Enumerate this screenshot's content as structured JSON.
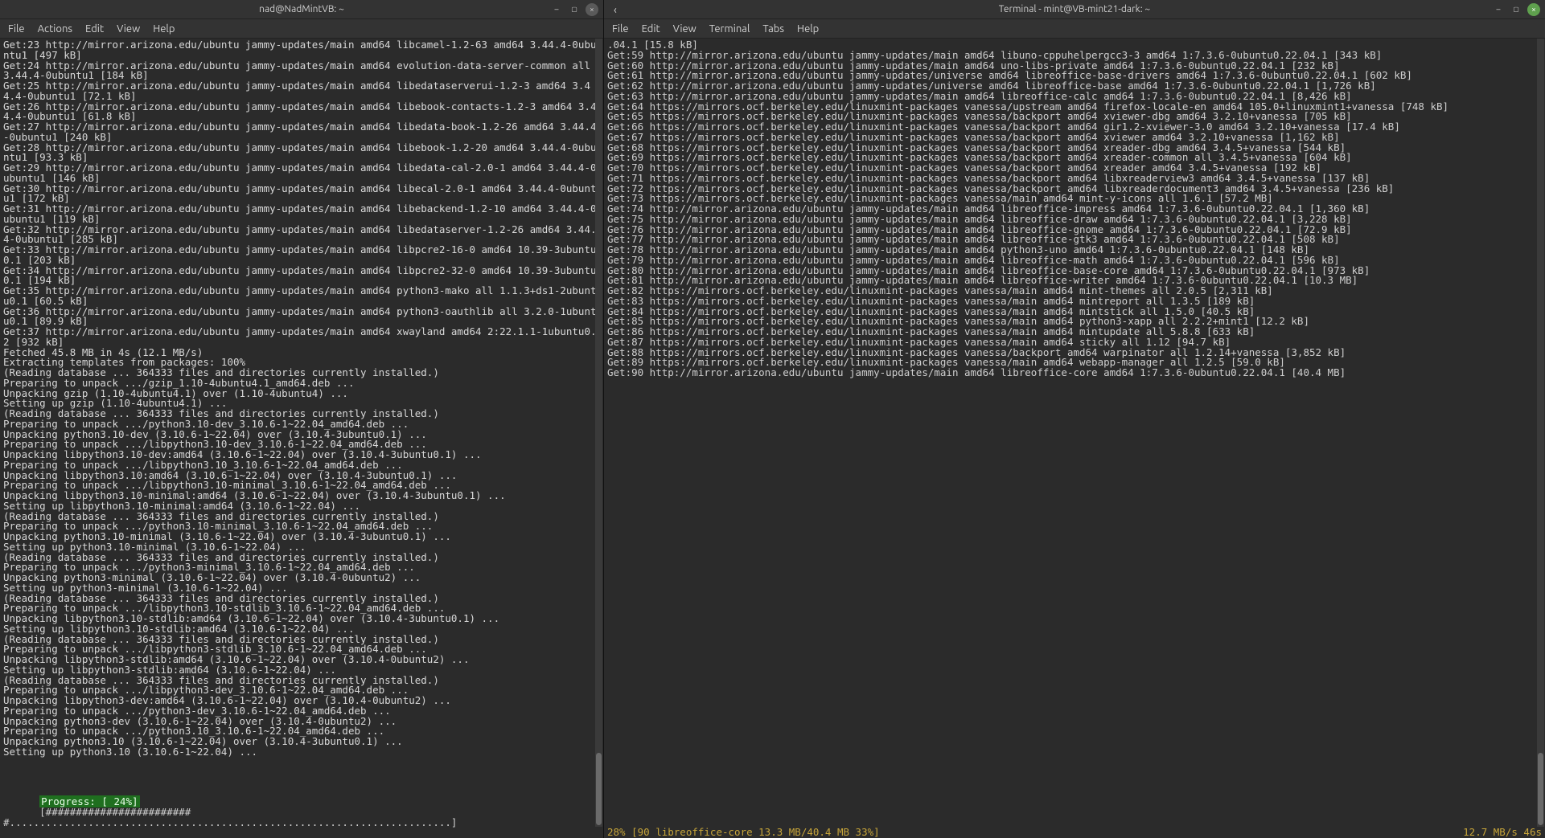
{
  "left": {
    "title": "nad@NadMintVB: ~",
    "menus": [
      "File",
      "Actions",
      "Edit",
      "View",
      "Help"
    ],
    "lines": [
      "Get:23 http://mirror.arizona.edu/ubuntu jammy-updates/main amd64 libcamel-1.2-63 amd64 3.44.4-0ubuntu1 [497 kB]",
      "Get:24 http://mirror.arizona.edu/ubuntu jammy-updates/main amd64 evolution-data-server-common all 3.44.4-0ubuntu1 [184 kB]",
      "Get:25 http://mirror.arizona.edu/ubuntu jammy-updates/main amd64 libedataserverui-1.2-3 amd64 3.44.4-0ubuntu1 [72.1 kB]",
      "Get:26 http://mirror.arizona.edu/ubuntu jammy-updates/main amd64 libebook-contacts-1.2-3 amd64 3.44.4-0ubuntu1 [61.8 kB]",
      "Get:27 http://mirror.arizona.edu/ubuntu jammy-updates/main amd64 libedata-book-1.2-26 amd64 3.44.4-0ubuntu1 [240 kB]",
      "Get:28 http://mirror.arizona.edu/ubuntu jammy-updates/main amd64 libebook-1.2-20 amd64 3.44.4-0ubuntu1 [93.3 kB]",
      "Get:29 http://mirror.arizona.edu/ubuntu jammy-updates/main amd64 libedata-cal-2.0-1 amd64 3.44.4-0ubuntu1 [146 kB]",
      "Get:30 http://mirror.arizona.edu/ubuntu jammy-updates/main amd64 libecal-2.0-1 amd64 3.44.4-0ubuntu1 [172 kB]",
      "Get:31 http://mirror.arizona.edu/ubuntu jammy-updates/main amd64 libebackend-1.2-10 amd64 3.44.4-0ubuntu1 [119 kB]",
      "Get:32 http://mirror.arizona.edu/ubuntu jammy-updates/main amd64 libedataserver-1.2-26 amd64 3.44.4-0ubuntu1 [285 kB]",
      "Get:33 http://mirror.arizona.edu/ubuntu jammy-updates/main amd64 libpcre2-16-0 amd64 10.39-3ubuntu0.1 [203 kB]",
      "Get:34 http://mirror.arizona.edu/ubuntu jammy-updates/main amd64 libpcre2-32-0 amd64 10.39-3ubuntu0.1 [194 kB]",
      "Get:35 http://mirror.arizona.edu/ubuntu jammy-updates/main amd64 python3-mako all 1.1.3+ds1-2ubuntu0.1 [60.5 kB]",
      "Get:36 http://mirror.arizona.edu/ubuntu jammy-updates/main amd64 python3-oauthlib all 3.2.0-1ubuntu0.1 [89.9 kB]",
      "Get:37 http://mirror.arizona.edu/ubuntu jammy-updates/main amd64 xwayland amd64 2:22.1.1-1ubuntu0.2 [932 kB]",
      "Fetched 45.8 MB in 4s (12.1 MB/s)",
      "Extracting templates from packages: 100%",
      "(Reading database ... 364333 files and directories currently installed.)",
      "Preparing to unpack .../gzip_1.10-4ubuntu4.1_amd64.deb ...",
      "Unpacking gzip (1.10-4ubuntu4.1) over (1.10-4ubuntu4) ...",
      "Setting up gzip (1.10-4ubuntu4.1) ...",
      "(Reading database ... 364333 files and directories currently installed.)",
      "Preparing to unpack .../python3.10-dev_3.10.6-1~22.04_amd64.deb ...",
      "Unpacking python3.10-dev (3.10.6-1~22.04) over (3.10.4-3ubuntu0.1) ...",
      "Preparing to unpack .../libpython3.10-dev_3.10.6-1~22.04_amd64.deb ...",
      "Unpacking libpython3.10-dev:amd64 (3.10.6-1~22.04) over (3.10.4-3ubuntu0.1) ...",
      "Preparing to unpack .../libpython3.10_3.10.6-1~22.04_amd64.deb ...",
      "Unpacking libpython3.10:amd64 (3.10.6-1~22.04) over (3.10.4-3ubuntu0.1) ...",
      "Preparing to unpack .../libpython3.10-minimal_3.10.6-1~22.04_amd64.deb ...",
      "Unpacking libpython3.10-minimal:amd64 (3.10.6-1~22.04) over (3.10.4-3ubuntu0.1) ...",
      "Setting up libpython3.10-minimal:amd64 (3.10.6-1~22.04) ...",
      "(Reading database ... 364333 files and directories currently installed.)",
      "Preparing to unpack .../python3.10-minimal_3.10.6-1~22.04_amd64.deb ...",
      "Unpacking python3.10-minimal (3.10.6-1~22.04) over (3.10.4-3ubuntu0.1) ...",
      "Setting up python3.10-minimal (3.10.6-1~22.04) ...",
      "(Reading database ... 364333 files and directories currently installed.)",
      "Preparing to unpack .../python3-minimal_3.10.6-1~22.04_amd64.deb ...",
      "Unpacking python3-minimal (3.10.6-1~22.04) over (3.10.4-0ubuntu2) ...",
      "Setting up python3-minimal (3.10.6-1~22.04) ...",
      "(Reading database ... 364333 files and directories currently installed.)",
      "Preparing to unpack .../libpython3.10-stdlib_3.10.6-1~22.04_amd64.deb ...",
      "Unpacking libpython3.10-stdlib:amd64 (3.10.6-1~22.04) over (3.10.4-3ubuntu0.1) ...",
      "Setting up libpython3.10-stdlib:amd64 (3.10.6-1~22.04) ...",
      "(Reading database ... 364333 files and directories currently installed.)",
      "Preparing to unpack .../libpython3-stdlib_3.10.6-1~22.04_amd64.deb ...",
      "Unpacking libpython3-stdlib:amd64 (3.10.6-1~22.04) over (3.10.4-0ubuntu2) ...",
      "Setting up libpython3-stdlib:amd64 (3.10.6-1~22.04) ...",
      "(Reading database ... 364333 files and directories currently installed.)",
      "Preparing to unpack .../libpython3-dev_3.10.6-1~22.04_amd64.deb ...",
      "Unpacking libpython3-dev:amd64 (3.10.6-1~22.04) over (3.10.4-0ubuntu2) ...",
      "Preparing to unpack .../python3-dev_3.10.6-1~22.04_amd64.deb ...",
      "Unpacking python3-dev (3.10.6-1~22.04) over (3.10.4-0ubuntu2) ...",
      "Preparing to unpack .../python3.10_3.10.6-1~22.04_amd64.deb ...",
      "Unpacking python3.10 (3.10.6-1~22.04) over (3.10.4-3ubuntu0.1) ...",
      "Setting up python3.10 (3.10.6-1~22.04) ..."
    ],
    "progress": {
      "label": "Progress: [ 24%]",
      "bar": "[#########################.........................................................................]"
    }
  },
  "right": {
    "title": "Terminal - mint@VB-mint21-dark: ~",
    "menus": [
      "File",
      "Edit",
      "View",
      "Terminal",
      "Tabs",
      "Help"
    ],
    "lines": [
      ".04.1 [15.8 kB]",
      "Get:59 http://mirror.arizona.edu/ubuntu jammy-updates/main amd64 libuno-cppuhelpergcc3-3 amd64 1:7.3.6-0ubuntu0.22.04.1 [343 kB]",
      "Get:60 http://mirror.arizona.edu/ubuntu jammy-updates/main amd64 uno-libs-private amd64 1:7.3.6-0ubuntu0.22.04.1 [232 kB]",
      "Get:61 http://mirror.arizona.edu/ubuntu jammy-updates/universe amd64 libreoffice-base-drivers amd64 1:7.3.6-0ubuntu0.22.04.1 [602 kB]",
      "Get:62 http://mirror.arizona.edu/ubuntu jammy-updates/universe amd64 libreoffice-base amd64 1:7.3.6-0ubuntu0.22.04.1 [1,726 kB]",
      "Get:63 http://mirror.arizona.edu/ubuntu jammy-updates/main amd64 libreoffice-calc amd64 1:7.3.6-0ubuntu0.22.04.1 [8,426 kB]",
      "Get:64 https://mirrors.ocf.berkeley.edu/linuxmint-packages vanessa/upstream amd64 firefox-locale-en amd64 105.0+linuxmint1+vanessa [748 kB]",
      "Get:65 https://mirrors.ocf.berkeley.edu/linuxmint-packages vanessa/backport amd64 xviewer-dbg amd64 3.2.10+vanessa [705 kB]",
      "Get:66 https://mirrors.ocf.berkeley.edu/linuxmint-packages vanessa/backport amd64 gir1.2-xviewer-3.0 amd64 3.2.10+vanessa [17.4 kB]",
      "Get:67 https://mirrors.ocf.berkeley.edu/linuxmint-packages vanessa/backport amd64 xviewer amd64 3.2.10+vanessa [1,162 kB]",
      "Get:68 https://mirrors.ocf.berkeley.edu/linuxmint-packages vanessa/backport amd64 xreader-dbg amd64 3.4.5+vanessa [544 kB]",
      "Get:69 https://mirrors.ocf.berkeley.edu/linuxmint-packages vanessa/backport amd64 xreader-common all 3.4.5+vanessa [604 kB]",
      "Get:70 https://mirrors.ocf.berkeley.edu/linuxmint-packages vanessa/backport amd64 xreader amd64 3.4.5+vanessa [192 kB]",
      "Get:71 https://mirrors.ocf.berkeley.edu/linuxmint-packages vanessa/backport amd64 libxreaderview3 amd64 3.4.5+vanessa [137 kB]",
      "Get:72 https://mirrors.ocf.berkeley.edu/linuxmint-packages vanessa/backport amd64 libxreaderdocument3 amd64 3.4.5+vanessa [236 kB]",
      "Get:73 https://mirrors.ocf.berkeley.edu/linuxmint-packages vanessa/main amd64 mint-y-icons all 1.6.1 [57.2 MB]",
      "Get:74 http://mirror.arizona.edu/ubuntu jammy-updates/main amd64 libreoffice-impress amd64 1:7.3.6-0ubuntu0.22.04.1 [1,360 kB]",
      "Get:75 http://mirror.arizona.edu/ubuntu jammy-updates/main amd64 libreoffice-draw amd64 1:7.3.6-0ubuntu0.22.04.1 [3,228 kB]",
      "Get:76 http://mirror.arizona.edu/ubuntu jammy-updates/main amd64 libreoffice-gnome amd64 1:7.3.6-0ubuntu0.22.04.1 [72.9 kB]",
      "Get:77 http://mirror.arizona.edu/ubuntu jammy-updates/main amd64 libreoffice-gtk3 amd64 1:7.3.6-0ubuntu0.22.04.1 [508 kB]",
      "Get:78 http://mirror.arizona.edu/ubuntu jammy-updates/main amd64 python3-uno amd64 1:7.3.6-0ubuntu0.22.04.1 [148 kB]",
      "Get:79 http://mirror.arizona.edu/ubuntu jammy-updates/main amd64 libreoffice-math amd64 1:7.3.6-0ubuntu0.22.04.1 [596 kB]",
      "Get:80 http://mirror.arizona.edu/ubuntu jammy-updates/main amd64 libreoffice-base-core amd64 1:7.3.6-0ubuntu0.22.04.1 [973 kB]",
      "Get:81 http://mirror.arizona.edu/ubuntu jammy-updates/main amd64 libreoffice-writer amd64 1:7.3.6-0ubuntu0.22.04.1 [10.3 MB]",
      "Get:82 https://mirrors.ocf.berkeley.edu/linuxmint-packages vanessa/main amd64 mint-themes all 2.0.5 [2,311 kB]",
      "Get:83 https://mirrors.ocf.berkeley.edu/linuxmint-packages vanessa/main amd64 mintreport all 1.3.5 [189 kB]",
      "Get:84 https://mirrors.ocf.berkeley.edu/linuxmint-packages vanessa/main amd64 mintstick all 1.5.0 [40.5 kB]",
      "Get:85 https://mirrors.ocf.berkeley.edu/linuxmint-packages vanessa/main amd64 python3-xapp all 2.2.2+mint1 [12.2 kB]",
      "Get:86 https://mirrors.ocf.berkeley.edu/linuxmint-packages vanessa/main amd64 mintupdate all 5.8.8 [633 kB]",
      "Get:87 https://mirrors.ocf.berkeley.edu/linuxmint-packages vanessa/main amd64 sticky all 1.12 [94.7 kB]",
      "Get:88 https://mirrors.ocf.berkeley.edu/linuxmint-packages vanessa/backport amd64 warpinator all 1.2.14+vanessa [3,852 kB]",
      "Get:89 https://mirrors.ocf.berkeley.edu/linuxmint-packages vanessa/main amd64 webapp-manager all 1.2.5 [59.0 kB]",
      "Get:90 http://mirror.arizona.edu/ubuntu jammy-updates/main amd64 libreoffice-core amd64 1:7.3.6-0ubuntu0.22.04.1 [40.4 MB]"
    ],
    "status": {
      "left": "28% [90 libreoffice-core 13.3 MB/40.4 MB 33%]",
      "right": "12.7 MB/s 46s"
    }
  }
}
